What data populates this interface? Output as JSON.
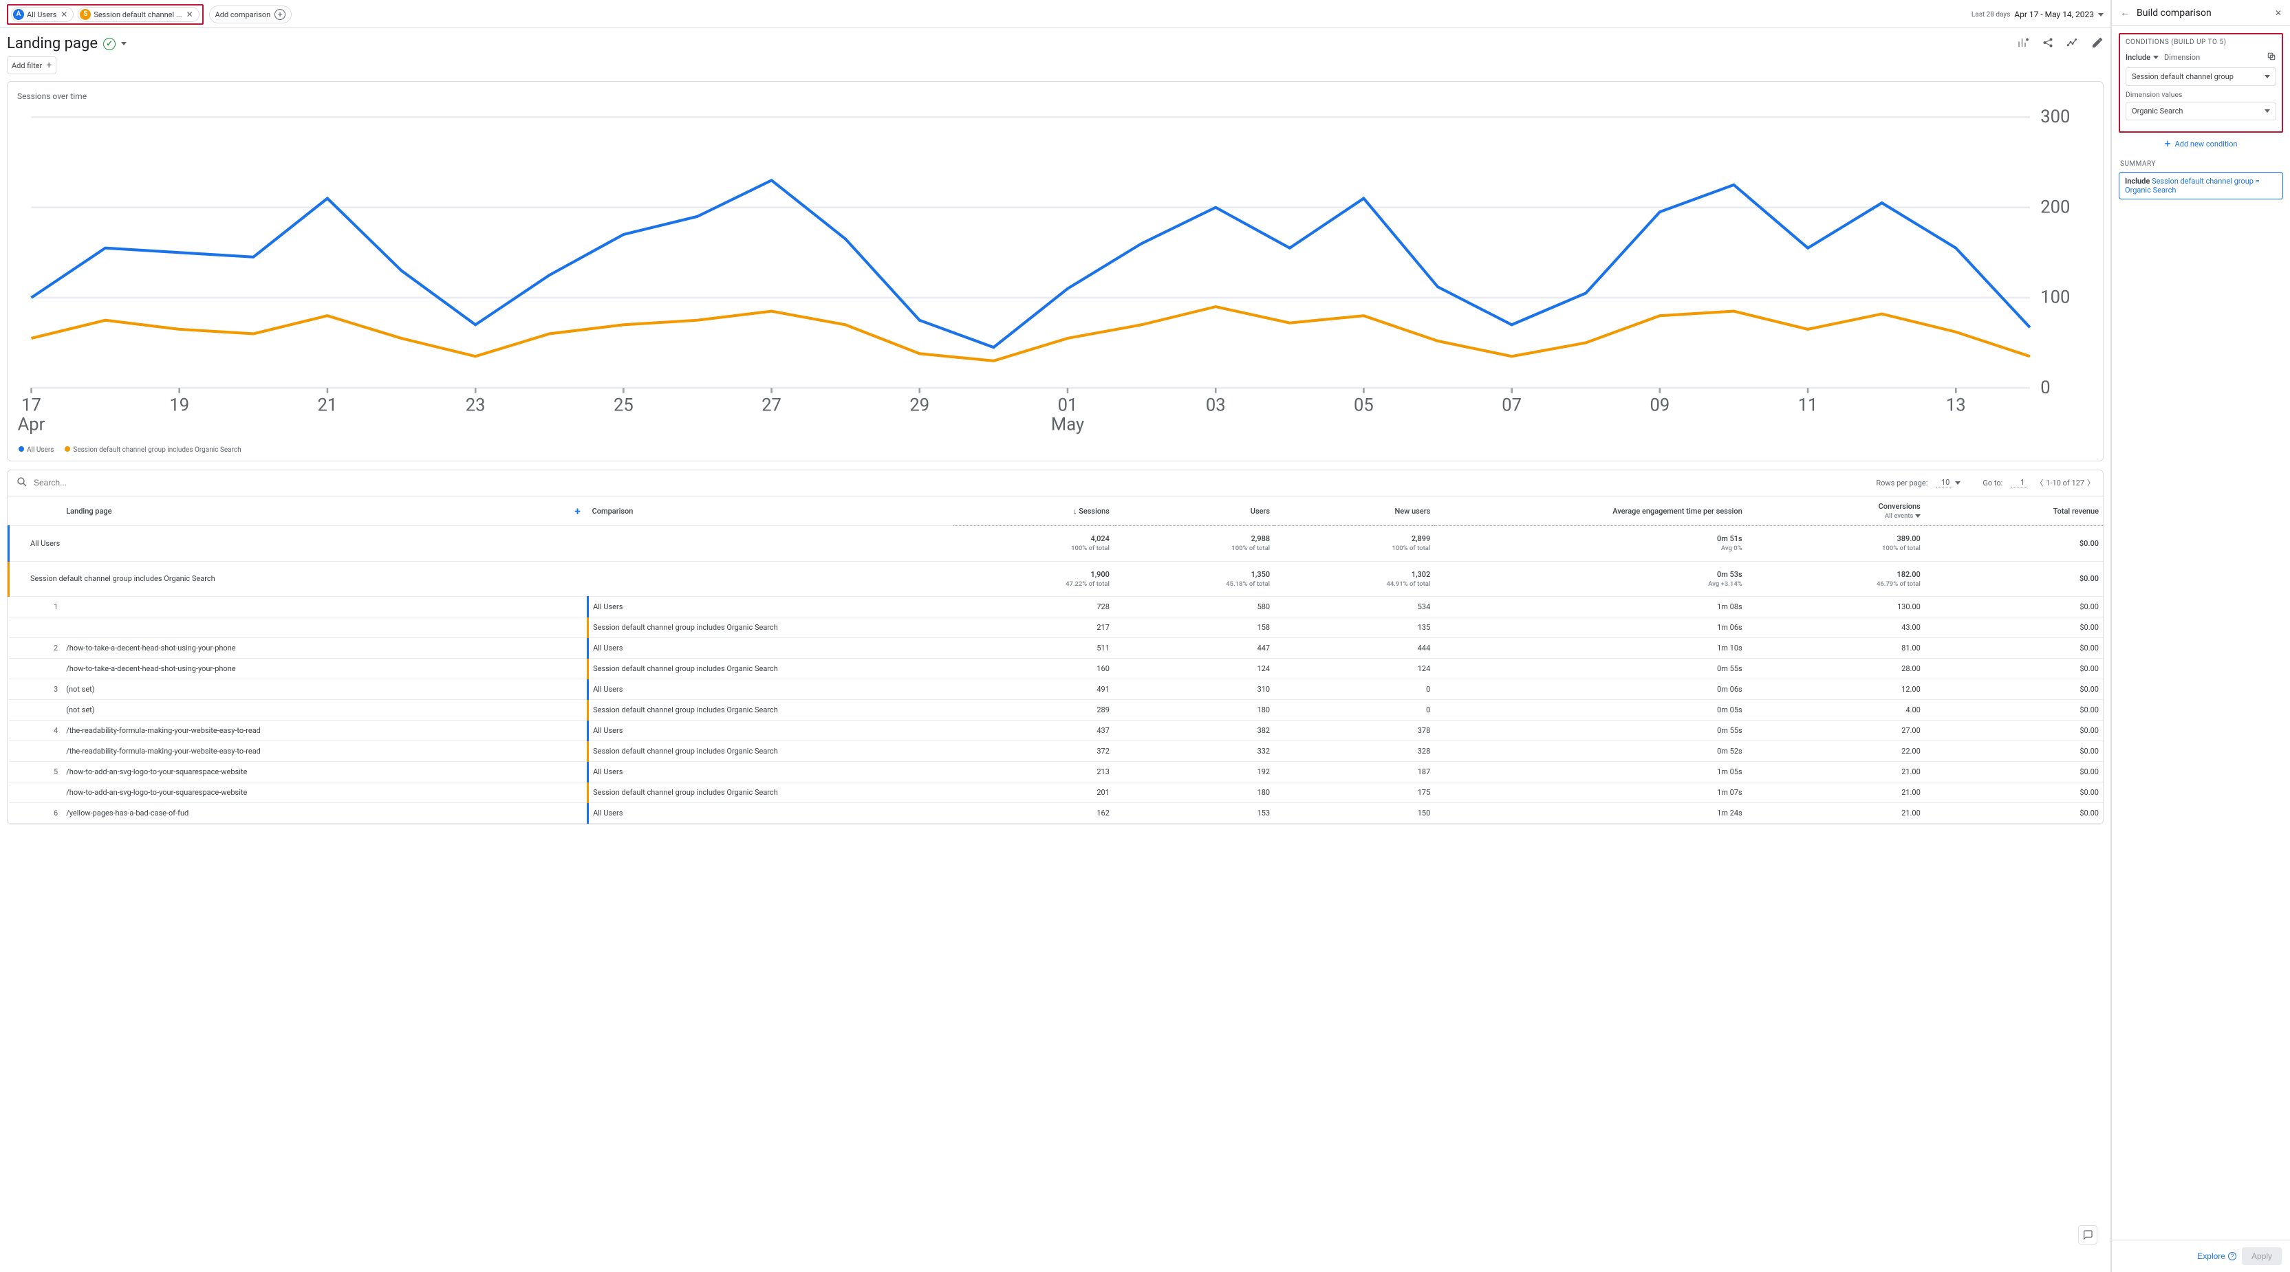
{
  "topbar": {
    "chip_a_label": "All Users",
    "chip_s_label": "Session default channel ...",
    "add_comparison_label": "Add comparison",
    "date_prefix": "Last 28 days",
    "date_range": "Apr 17 - May 14, 2023"
  },
  "title": {
    "page_title": "Landing page",
    "add_filter": "Add filter"
  },
  "chart_card": {
    "title": "Sessions over time",
    "legend_a": "All Users",
    "legend_b": "Session default channel group includes Organic Search"
  },
  "chart_data": {
    "type": "line",
    "x_labels_top": [
      "17",
      "19",
      "21",
      "23",
      "25",
      "27",
      "29",
      "01",
      "03",
      "05",
      "07",
      "09",
      "11",
      "13"
    ],
    "x_labels_bottom": [
      "Apr",
      "",
      "",
      "",
      "",
      "",
      "",
      "May",
      "",
      "",
      "",
      "",
      "",
      ""
    ],
    "ylim": [
      0,
      300
    ],
    "y_ticks": [
      0,
      100,
      200,
      300
    ],
    "series": [
      {
        "name": "All Users",
        "color": "#1a73e8",
        "x": [
          17,
          18,
          19,
          20,
          21,
          22,
          23,
          24,
          25,
          26,
          27,
          28,
          29,
          30,
          31,
          32,
          33,
          34,
          35,
          36,
          37,
          38,
          39,
          40,
          41,
          42,
          43,
          44
        ],
        "values": [
          100,
          155,
          150,
          145,
          210,
          130,
          70,
          125,
          170,
          190,
          230,
          165,
          75,
          45,
          110,
          160,
          200,
          155,
          210,
          112,
          70,
          105,
          195,
          225,
          155,
          205,
          155,
          67
        ]
      },
      {
        "name": "Session default channel group includes Organic Search",
        "color": "#f29900",
        "x": [
          17,
          18,
          19,
          20,
          21,
          22,
          23,
          24,
          25,
          26,
          27,
          28,
          29,
          30,
          31,
          32,
          33,
          34,
          35,
          36,
          37,
          38,
          39,
          40,
          41,
          42,
          43,
          44
        ],
        "values": [
          55,
          75,
          65,
          60,
          80,
          55,
          35,
          60,
          70,
          75,
          85,
          70,
          38,
          30,
          55,
          70,
          90,
          72,
          80,
          52,
          35,
          50,
          80,
          85,
          65,
          82,
          62,
          35
        ]
      }
    ]
  },
  "table_tools": {
    "search_placeholder": "Search...",
    "rows_label": "Rows per page:",
    "rows_value": "10",
    "goto_label": "Go to:",
    "goto_value": "1",
    "page_text": "1-10 of 127"
  },
  "table_header": {
    "landing_page": "Landing page",
    "comparison": "Comparison",
    "sessions": "Sessions",
    "users": "Users",
    "new_users": "New users",
    "aet": "Average engagement time per session",
    "conversions": "Conversions",
    "conversions_sub": "All events",
    "revenue": "Total revenue"
  },
  "totals": [
    {
      "label": "All Users",
      "color": "blue",
      "sessions": "4,024",
      "sessions_pct": "100% of total",
      "users": "2,988",
      "users_pct": "100% of total",
      "new_users": "2,899",
      "new_users_pct": "100% of total",
      "aet": "0m 51s",
      "aet_pct": "Avg 0%",
      "conv": "389.00",
      "conv_pct": "100% of total",
      "rev": "$0.00"
    },
    {
      "label": "Session default channel group includes Organic Search",
      "color": "orange",
      "sessions": "1,900",
      "sessions_pct": "47.22% of total",
      "users": "1,350",
      "users_pct": "45.18% of total",
      "new_users": "1,302",
      "new_users_pct": "44.91% of total",
      "aet": "0m 53s",
      "aet_pct": "Avg +3.14%",
      "conv": "182.00",
      "conv_pct": "46.79% of total",
      "rev": "$0.00"
    }
  ],
  "rows": [
    {
      "idx": "1",
      "page": "",
      "a": {
        "seg": "All Users",
        "sessions": "728",
        "users": "580",
        "new": "534",
        "aet": "1m 08s",
        "conv": "130.00",
        "rev": "$0.00"
      },
      "b": {
        "seg": "Session default channel group includes Organic Search",
        "sessions": "217",
        "users": "158",
        "new": "135",
        "aet": "1m 06s",
        "conv": "43.00",
        "rev": "$0.00"
      }
    },
    {
      "idx": "2",
      "page": "/how-to-take-a-decent-head-shot-using-your-phone",
      "a": {
        "seg": "All Users",
        "sessions": "511",
        "users": "447",
        "new": "444",
        "aet": "1m 10s",
        "conv": "81.00",
        "rev": "$0.00"
      },
      "b": {
        "seg": "Session default channel group includes Organic Search",
        "sessions": "160",
        "users": "124",
        "new": "124",
        "aet": "0m 55s",
        "conv": "28.00",
        "rev": "$0.00"
      }
    },
    {
      "idx": "3",
      "page": "(not set)",
      "a": {
        "seg": "All Users",
        "sessions": "491",
        "users": "310",
        "new": "0",
        "aet": "0m 06s",
        "conv": "12.00",
        "rev": "$0.00"
      },
      "b": {
        "seg": "Session default channel group includes Organic Search",
        "sessions": "289",
        "users": "180",
        "new": "0",
        "aet": "0m 05s",
        "conv": "4.00",
        "rev": "$0.00"
      }
    },
    {
      "idx": "4",
      "page": "/the-readability-formula-making-your-website-easy-to-read",
      "a": {
        "seg": "All Users",
        "sessions": "437",
        "users": "382",
        "new": "378",
        "aet": "0m 55s",
        "conv": "27.00",
        "rev": "$0.00"
      },
      "b": {
        "seg": "Session default channel group includes Organic Search",
        "sessions": "372",
        "users": "332",
        "new": "328",
        "aet": "0m 52s",
        "conv": "22.00",
        "rev": "$0.00"
      }
    },
    {
      "idx": "5",
      "page": "/how-to-add-an-svg-logo-to-your-squarespace-website",
      "a": {
        "seg": "All Users",
        "sessions": "213",
        "users": "192",
        "new": "187",
        "aet": "1m 05s",
        "conv": "21.00",
        "rev": "$0.00"
      },
      "b": {
        "seg": "Session default channel group includes Organic Search",
        "sessions": "201",
        "users": "180",
        "new": "175",
        "aet": "1m 07s",
        "conv": "21.00",
        "rev": "$0.00"
      }
    },
    {
      "idx": "6",
      "page": "/yellow-pages-has-a-bad-case-of-fud",
      "a": {
        "seg": "All Users",
        "sessions": "162",
        "users": "153",
        "new": "150",
        "aet": "1m 24s",
        "conv": "21.00",
        "rev": "$0.00"
      },
      "b": null
    }
  ],
  "panel": {
    "title": "Build comparison",
    "conditions_title": "Conditions (build up to 5)",
    "include": "Include",
    "dimension_label": "Dimension",
    "dim_select": "Session default channel group",
    "dim_values_label": "Dimension values",
    "dim_value_select": "Organic Search",
    "add_condition": "Add new condition",
    "summary_title": "Summary",
    "summary_include": "Include",
    "summary_text": "Session default channel group = Organic Search",
    "explore": "Explore",
    "apply": "Apply"
  }
}
